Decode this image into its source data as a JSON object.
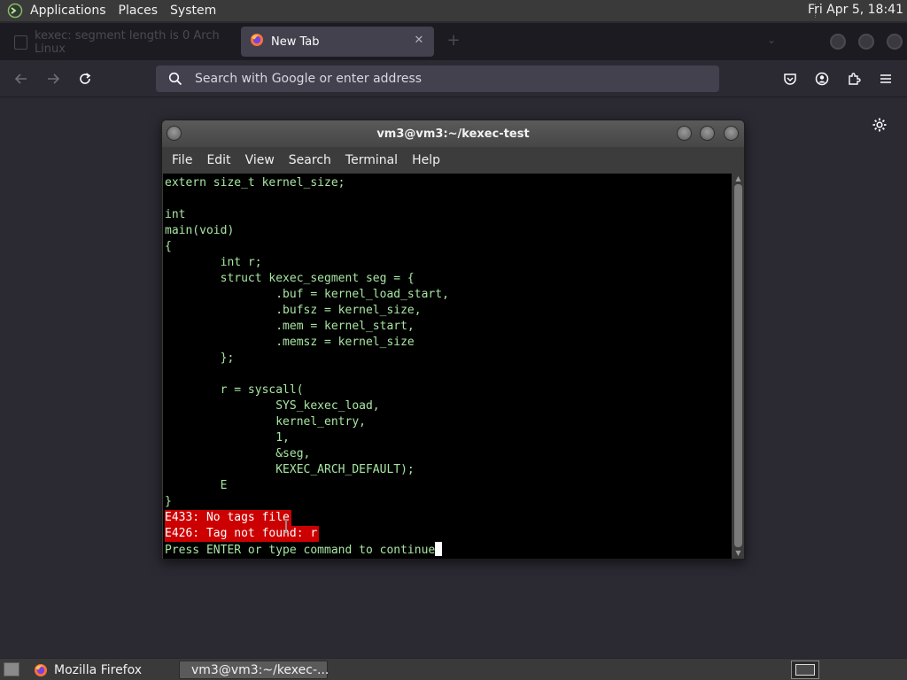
{
  "top_panel": {
    "menus": [
      "Applications",
      "Places",
      "System"
    ],
    "clock": "Fri Apr  5, 18:41"
  },
  "firefox": {
    "inactive_tab_title": "kexec: segment length is 0 Arch Linux",
    "active_tab_title": "New Tab",
    "url_placeholder": "Search with Google or enter address"
  },
  "terminal": {
    "title": "vm3@vm3:~/kexec-test",
    "menus": [
      "File",
      "Edit",
      "View",
      "Search",
      "Terminal",
      "Help"
    ],
    "lines": [
      "extern size_t kernel_size;",
      "",
      "int",
      "main(void)",
      "{",
      "        int r;",
      "        struct kexec_segment seg = {",
      "                .buf = kernel_load_start,",
      "                .bufsz = kernel_size,",
      "                .mem = kernel_start,",
      "                .memsz = kernel_size",
      "        };",
      "",
      "        r = syscall(",
      "                SYS_kexec_load,",
      "                kernel_entry,",
      "                1,",
      "                &seg,",
      "                KEXEC_ARCH_DEFAULT);",
      "        E",
      "}"
    ],
    "errors": [
      "E433: No tags file",
      "E426: Tag not found: r"
    ],
    "prompt": "Press ENTER or type command to continue"
  },
  "taskbar": {
    "items": [
      "Mozilla Firefox",
      "vm3@vm3:~/kexec-..."
    ]
  },
  "colors": {
    "terminal_text": "#a8e6a3",
    "error_bg": "#cc0000",
    "firefox_bg": "#2b2a33"
  }
}
